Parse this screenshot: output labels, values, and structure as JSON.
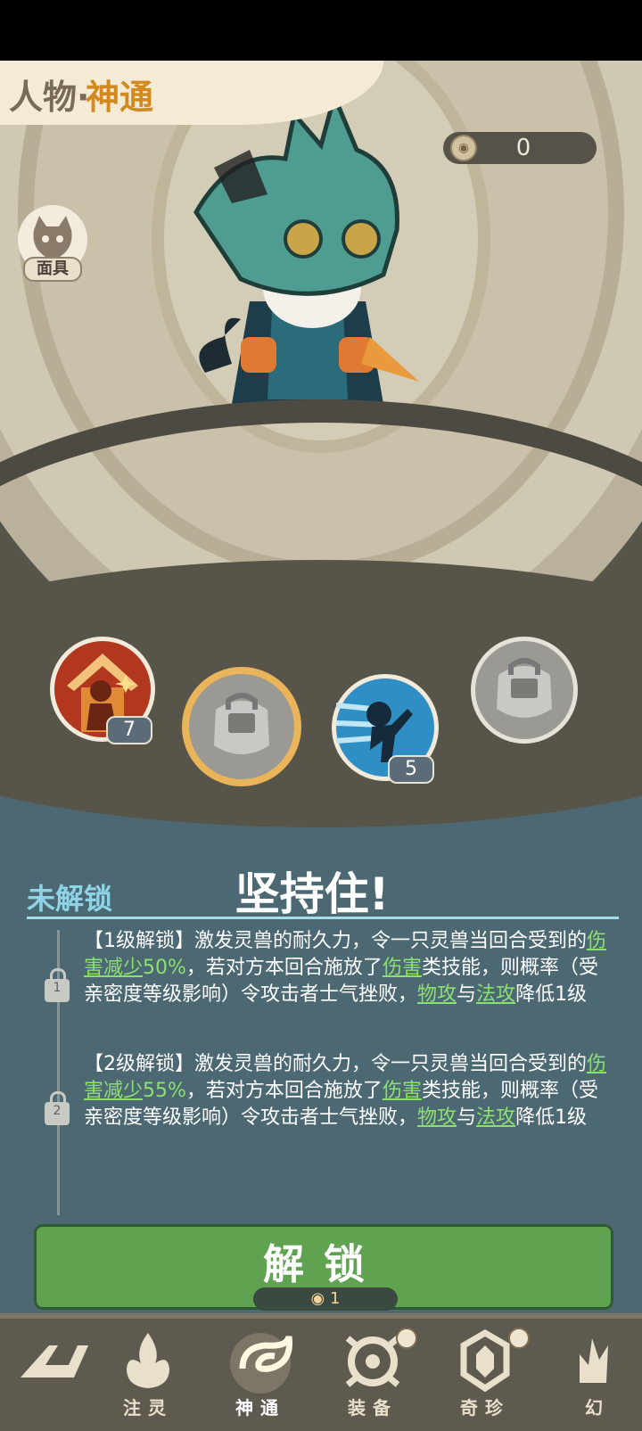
{
  "header": {
    "title_left": "人物·",
    "title_right": "神通"
  },
  "currency": {
    "icon": "coin-icon",
    "value": "0"
  },
  "mask_button": {
    "label": "面具"
  },
  "skills": [
    {
      "level": "7",
      "state": "unlocked",
      "icon": "house-gesture-icon"
    },
    {
      "level": "",
      "state": "selected-locked",
      "icon": "mask-lock-icon"
    },
    {
      "level": "5",
      "state": "unlocked",
      "icon": "dash-figure-icon"
    },
    {
      "level": "",
      "state": "locked",
      "icon": "mask-lock-icon"
    }
  ],
  "detail": {
    "status": "未解锁",
    "name": "坚持住!",
    "levels": [
      {
        "lock_num": "1",
        "p1": "【1级解锁】激发灵兽的耐久力，令一只灵兽当回合受到的",
        "link1": "伤害减少",
        "num": "50%",
        "p2": "，若对方本回合施放了",
        "link2": "伤害",
        "p3": "类技能，则概率（受亲密度等级影响）令攻击者士气挫败，",
        "link3": "物攻",
        "p4": "与",
        "link4": "法攻",
        "p5": "降低1级"
      },
      {
        "lock_num": "2",
        "p1": "【2级解锁】激发灵兽的耐久力，令一只灵兽当回合受到的",
        "link1": "伤害减少",
        "num": "55%",
        "p2": "，若对方本回合施放了",
        "link2": "伤害",
        "p3": "类技能，则概率（受亲密度等级影响）令攻击者士气挫败，",
        "link3": "物攻",
        "p4": "与",
        "link4": "法攻",
        "p5": "降低1级"
      }
    ]
  },
  "unlock_button": {
    "label": "解锁",
    "cost": "1"
  },
  "nav": [
    {
      "label": "",
      "icon": "back-arrow-icon"
    },
    {
      "label": "注灵",
      "icon": "flame-spirit-icon"
    },
    {
      "label": "神通",
      "icon": "swirl-icon",
      "active": true
    },
    {
      "label": "装备",
      "icon": "gear-eye-icon"
    },
    {
      "label": "奇珍",
      "icon": "gem-icon"
    },
    {
      "label": "幻",
      "icon": "fan-icon"
    }
  ]
}
